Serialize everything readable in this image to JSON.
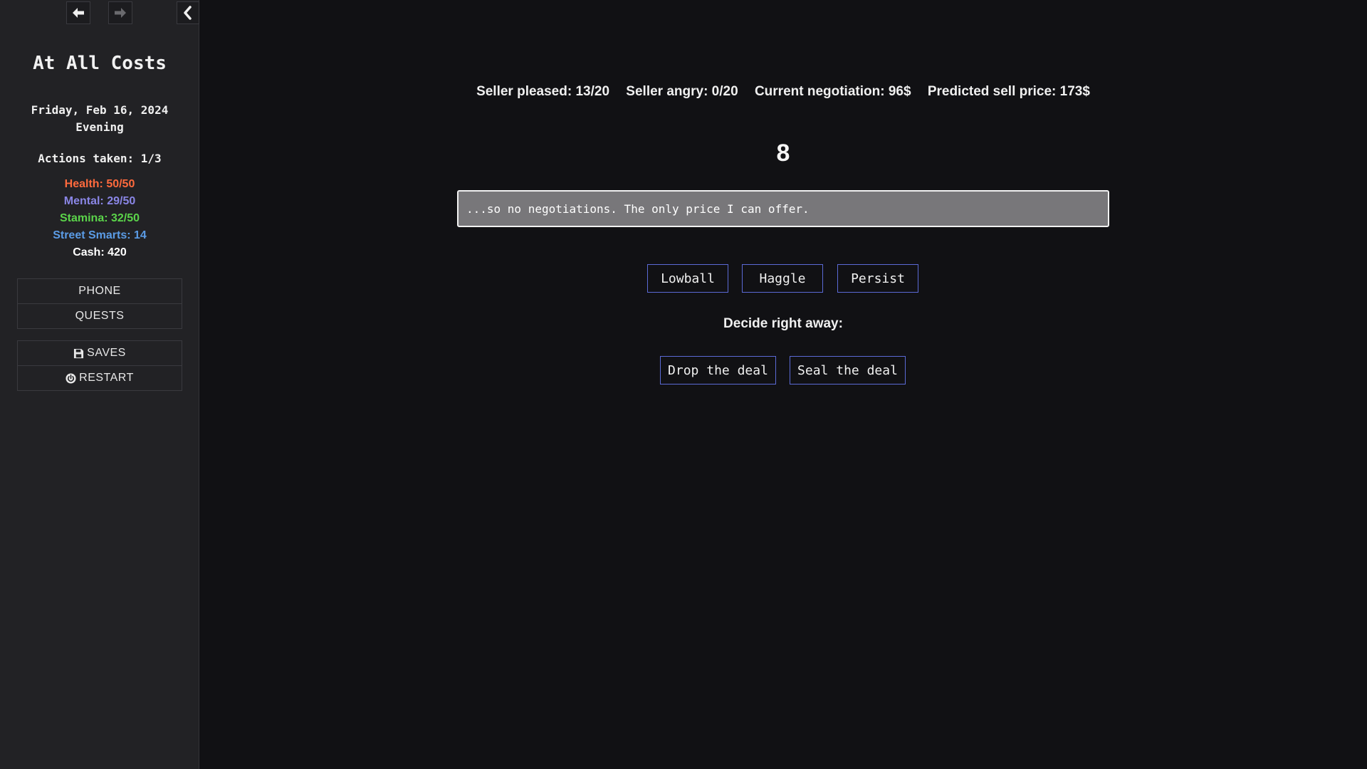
{
  "sidebar": {
    "title": "At All Costs",
    "date": "Friday, Feb 16, 2024",
    "time_of_day": "Evening",
    "actions": "Actions taken: 1/3",
    "stats": {
      "health": "Health: 50/50",
      "mental": "Mental: 29/50",
      "stamina": "Stamina: 32/50",
      "street_smarts": "Street Smarts: 14",
      "cash": "Cash: 420"
    },
    "menu": {
      "phone": "PHONE",
      "quests": "QUESTS",
      "saves": "SAVES",
      "restart": "RESTART"
    },
    "icons": {
      "back": "arrow-left-icon",
      "forward": "arrow-right-icon",
      "collapse": "chevron-left-icon",
      "saves": "floppy-disk-icon",
      "restart": "power-icon"
    }
  },
  "colors": {
    "health": "#ff6a3d",
    "mental": "#8a86e6",
    "stamina": "#5bd44a",
    "street_smarts": "#5b9ce6",
    "cash": "#ffffff",
    "choice_border": "#5b6ad6"
  },
  "negotiation": {
    "seller_pleased": "Seller pleased: 13/20",
    "seller_angry": "Seller angry: 0/20",
    "current": "Current negotiation: 96$",
    "predicted": "Predicted sell price: 173$",
    "counter": "8",
    "dialogue": "...so no negotiations. The only price I can offer.",
    "tactics": {
      "lowball": "Lowball",
      "haggle": "Haggle",
      "persist": "Persist"
    },
    "decide_prompt": "Decide right away:",
    "decisions": {
      "drop": "Drop the deal",
      "seal": "Seal the deal"
    }
  }
}
